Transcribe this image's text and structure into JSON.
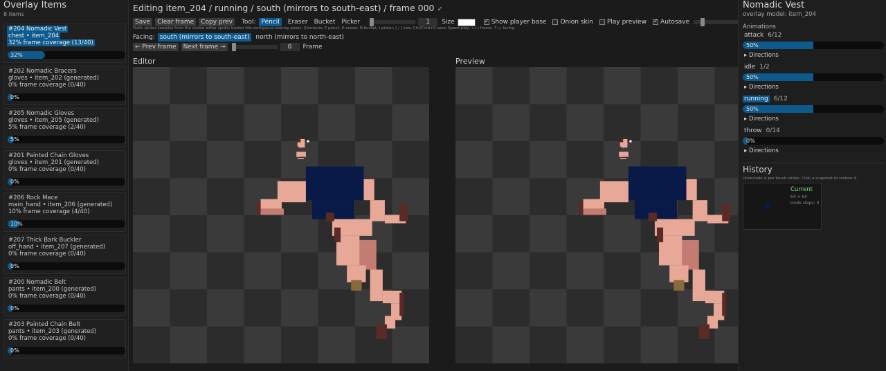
{
  "left_panel": {
    "title": "Overlay Items",
    "count": "8 items",
    "items": [
      {
        "name": "#204 Nomadic Vest",
        "slot": "chest • item_204",
        "coverage": "32% frame coverage (13/40)",
        "percent": 32,
        "percent_label": "32%",
        "selected": true
      },
      {
        "name": "#202 Nomadic Bracers",
        "slot": "gloves • item_202 (generated)",
        "coverage": "0% frame coverage (0/40)",
        "percent": 0,
        "percent_label": "0%",
        "selected": false
      },
      {
        "name": "#205 Nomadic Gloves",
        "slot": "gloves • item_205 (generated)",
        "coverage": "5% frame coverage (2/40)",
        "percent": 5,
        "percent_label": "5%",
        "selected": false
      },
      {
        "name": "#201 Painted Chain Gloves",
        "slot": "gloves • item_201 (generated)",
        "coverage": "0% frame coverage (0/40)",
        "percent": 0,
        "percent_label": "0%",
        "selected": false
      },
      {
        "name": "#206 Rock Mace",
        "slot": "main_hand • item_206 (generated)",
        "coverage": "10% frame coverage (4/40)",
        "percent": 10,
        "percent_label": "10%",
        "selected": false
      },
      {
        "name": "#207 Thick Bark Buckler",
        "slot": "off_hand • item_207 (generated)",
        "coverage": "0% frame coverage (0/40)",
        "percent": 0,
        "percent_label": "0%",
        "selected": false
      },
      {
        "name": "#200 Nomadic Belt",
        "slot": "pants • item_200 (generated)",
        "coverage": "0% frame coverage (0/40)",
        "percent": 0,
        "percent_label": "0%",
        "selected": false
      },
      {
        "name": "#203 Painted Chain Belt",
        "slot": "pants • item_203 (generated)",
        "coverage": "0% frame coverage (0/40)",
        "percent": 0,
        "percent_label": "0%",
        "selected": false
      }
    ]
  },
  "editor": {
    "title": "Editing item_204 / running / south (mirrors to south-east) / frame 000",
    "saved_mark": "✓",
    "toolbar": {
      "save": "Save",
      "clear_frame": "Clear frame",
      "copy_prev": "Copy prev",
      "tool_label": "Tool:",
      "tools": [
        "Pencil",
        "Eraser",
        "Bucket",
        "Picker"
      ],
      "active_tool": "Pencil",
      "brush_value": "1",
      "size_label": "Size",
      "brush_size_fraction": 0,
      "color_swatch": "#ffffff",
      "show_player_base": "Show player base",
      "show_player_base_checked": true,
      "onion_skin": "Onion skin",
      "onion_skin_checked": false,
      "play_preview": "Play preview",
      "play_preview_checked": false,
      "autosave": "Autosave",
      "autosave_checked": true,
      "autosave_slider_fraction": 0.15
    },
    "hint": "Tools: picker samples from the visible editor sprite; bucket fills contiguous overlay pixels.     Shortcuts: P pencil, E eraser, B bucket, I picker, [ / ] size, Ctrl/Cmd+S save, Space play, ←/→ frame, ↑/↓ facing",
    "facing_label": "Facing:",
    "facings": [
      "south (mirrors to south-east)",
      "north (mirrors to north-east)"
    ],
    "active_facing": "south (mirrors to south-east)",
    "prev_frame": "← Prev frame",
    "next_frame": "Next frame →",
    "frame_value": "0",
    "frame_label": "Frame",
    "frame_slider_fraction": 0,
    "editor_label": "Editor",
    "preview_label": "Preview",
    "colors": {
      "skin": "#e8a898",
      "skin_shade": "#c47c72",
      "outline": "#5a2a26",
      "vest": "#0a1a48",
      "accent": "#0f5a8c"
    }
  },
  "right_panel": {
    "title": "Nomadic Vest",
    "subtitle": "overlay model: item_204",
    "animations_header": "Animations",
    "animations": [
      {
        "name": "attack",
        "count": "6/12",
        "percent": 50,
        "percent_label": "50%",
        "selected": false
      },
      {
        "name": "idle",
        "count": "1/2",
        "percent": 50,
        "percent_label": "50%",
        "selected": false
      },
      {
        "name": "running",
        "count": "6/12",
        "percent": 50,
        "percent_label": "50%",
        "selected": true
      },
      {
        "name": "throw",
        "count": "0/14",
        "percent": 0,
        "percent_label": "0%",
        "selected": false
      }
    ],
    "directions_label": "▸ Directions",
    "history_title": "History",
    "history_hint": "Undo/redo is per brush stroke. Click a snapshot to restore it.",
    "snapshot": {
      "label": "Current",
      "size": "64 × 64",
      "undo": "Undo steps: 0"
    }
  }
}
